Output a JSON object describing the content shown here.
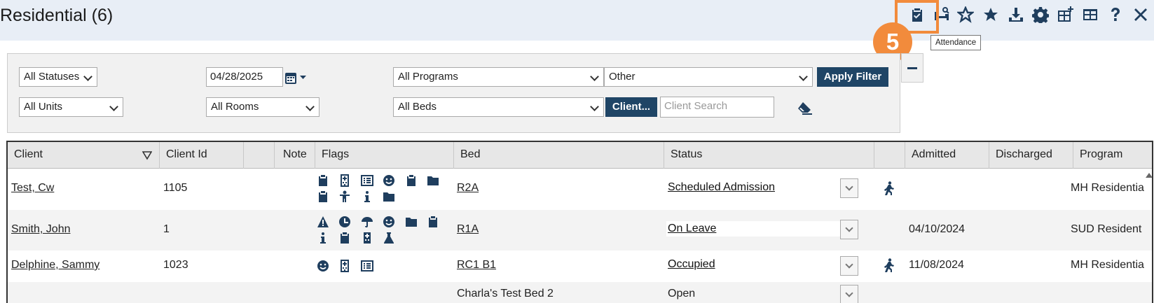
{
  "header": {
    "title": "Residential (6)",
    "toolbar_icons": [
      "attendance-clipboard-icon",
      "bed-search-icon",
      "favorite-outline-icon",
      "favorite-icon",
      "download-icon",
      "settings-icon",
      "add-grid-icon",
      "grid-icon",
      "help-icon",
      "close-icon"
    ],
    "tooltip": "Attendance",
    "step_badge": "5",
    "highlight_color": "#f28b3c",
    "accent_color": "#1f3e5e"
  },
  "filters": {
    "statuses": "All Statuses",
    "date": "04/28/2025",
    "programs": "All Programs",
    "other": "Other",
    "apply_label": "Apply Filter",
    "units": "All Units",
    "rooms": "All Rooms",
    "beds": "All Beds",
    "client_button": "Client...",
    "client_search_placeholder": "Client Search"
  },
  "table": {
    "columns": [
      "Client",
      "Client Id",
      "",
      "Note",
      "Flags",
      "Bed",
      "Status",
      "",
      "Admitted",
      "Discharged",
      "Program"
    ],
    "rows": [
      {
        "client": "Test, Cw",
        "client_id": "1105",
        "flags": [
          "clipboard-icon",
          "hospital-icon",
          "list-icon",
          "smile-icon",
          "clipboard-icon",
          "folder-icon",
          "clipboard-icon",
          "person-icon",
          "info-icon",
          "folder-icon"
        ],
        "bed": "R2A",
        "status": "Scheduled Admission",
        "movement_icon": true,
        "admitted": "",
        "discharged": "",
        "program": "MH Residentia"
      },
      {
        "client": "Smith, John",
        "client_id": "1",
        "flags": [
          "warning-icon",
          "clock-icon",
          "umbrella-icon",
          "smile-icon",
          "folder-icon",
          "clipboard-icon",
          "info-icon",
          "clipboard-icon",
          "hospital-icon",
          "flask-icon"
        ],
        "bed": "R1A",
        "status": "On Leave",
        "movement_icon": false,
        "admitted": "04/10/2024",
        "discharged": "",
        "program": "SUD Resident"
      },
      {
        "client": "Delphine, Sammy",
        "client_id": "1023",
        "flags": [
          "smile-icon",
          "hospital-icon",
          "list-icon"
        ],
        "bed": "RC1 B1",
        "status": "Occupied",
        "movement_icon": true,
        "admitted": "11/08/2024",
        "discharged": "",
        "program": "MH Residentia"
      },
      {
        "client": "",
        "client_id": "",
        "flags": [],
        "bed": "Charla's Test Bed 2",
        "status": "Open",
        "movement_icon": false,
        "admitted": "",
        "discharged": "",
        "program": ""
      }
    ]
  }
}
